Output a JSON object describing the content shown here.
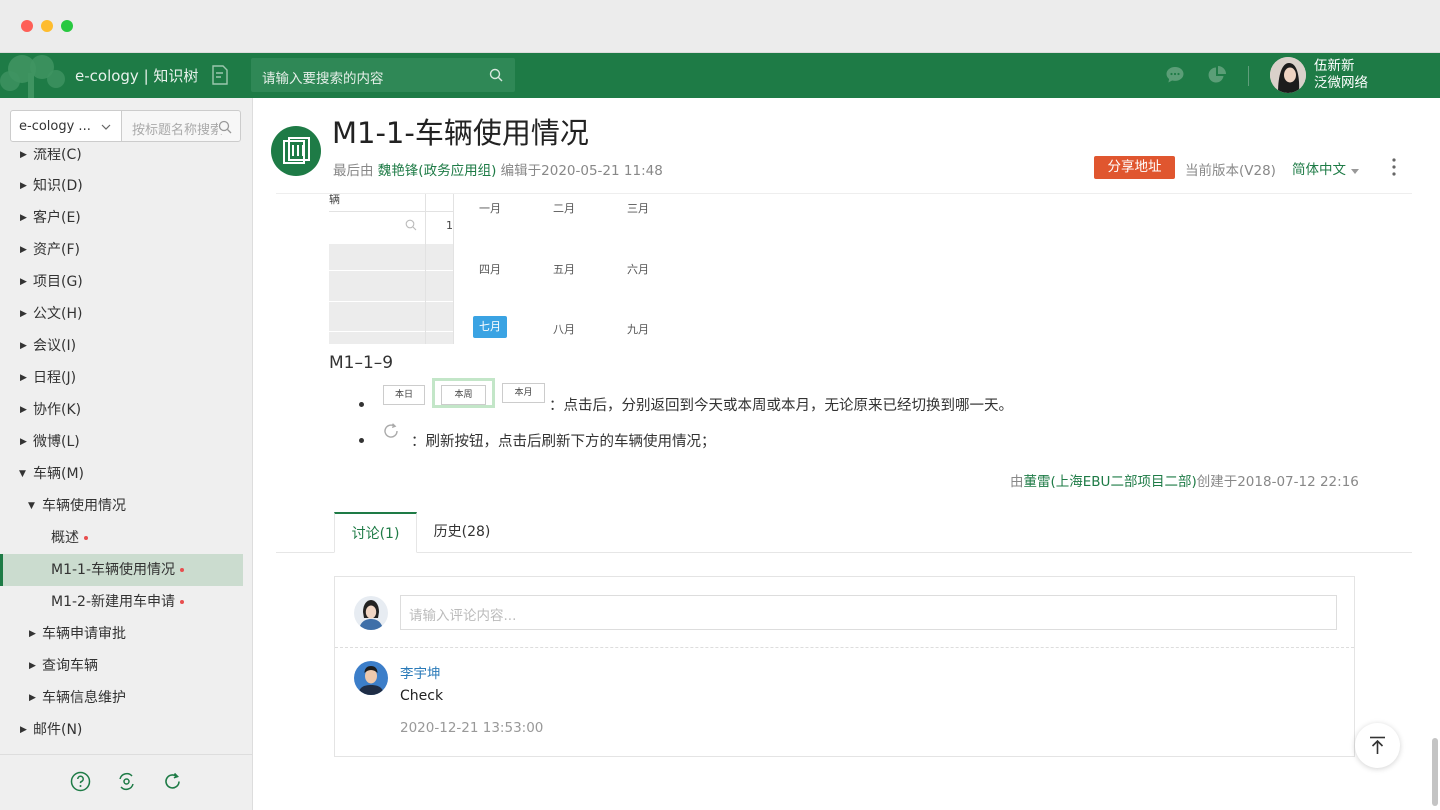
{
  "app": {
    "brand": "e-cology | 知识树",
    "search_placeholder": "请输入要搜索的内容",
    "user_name": "伍新新",
    "user_org": "泛微网络"
  },
  "sidebar": {
    "select_value": "e-cology ...",
    "search_placeholder": "按标题名称搜索",
    "cut_item": "流程(C)",
    "items": [
      {
        "label": "知识(D)"
      },
      {
        "label": "客户(E)"
      },
      {
        "label": "资产(F)"
      },
      {
        "label": "项目(G)"
      },
      {
        "label": "公文(H)"
      },
      {
        "label": "会议(I)"
      },
      {
        "label": "日程(J)"
      },
      {
        "label": "协作(K)"
      },
      {
        "label": "微博(L)"
      },
      {
        "label": "车辆(M)"
      },
      {
        "label": "车辆使用情况"
      },
      {
        "label": "概述"
      },
      {
        "label": "M1-1-车辆使用情况"
      },
      {
        "label": "M1-2-新建用车申请"
      },
      {
        "label": "车辆申请审批"
      },
      {
        "label": "查询车辆"
      },
      {
        "label": "车辆信息维护"
      },
      {
        "label": "邮件(N)"
      }
    ]
  },
  "doc": {
    "title": "M1-1-车辆使用情况",
    "meta_prefix": "最后由",
    "editor": "魏艳锋(政务应用组)",
    "edited": "编辑于2020-05-21 11:48",
    "share_label": "分享地址",
    "version": "当前版本(V28)",
    "language": "简体中文",
    "embedded": {
      "header_text": "辆",
      "cell_text": "1",
      "months": [
        "一月",
        "二月",
        "三月",
        "四月",
        "五月",
        "六月",
        "七月",
        "八月",
        "九月"
      ]
    },
    "section_title": "M1–1–9",
    "bullets": [
      {
        "text": "：点击后，分别返回到今天或本周或本月，无论原来已经切换到哪一天。",
        "buttons": [
          "本日",
          "本周",
          "本月"
        ]
      },
      {
        "text": "：刷新按钮，点击后刷新下方的车辆使用情况；"
      }
    ],
    "creator_prefix": "由",
    "creator": "董雷(上海EBU二部项目二部)",
    "created": "创建于2018-07-12 22:16"
  },
  "tabs": [
    {
      "label": "讨论(1)"
    },
    {
      "label": "历史(28)"
    }
  ],
  "comments": {
    "input_placeholder": "请输入评论内容...",
    "items": [
      {
        "author": "李宇坤",
        "text": "Check",
        "time": "2020-12-21 13:53:00"
      }
    ]
  },
  "colors": {
    "brand_green": "#1e7b46",
    "share_orange": "#e0562f",
    "month_active": "#3aa3e3",
    "author_blue": "#2a7ab8"
  }
}
